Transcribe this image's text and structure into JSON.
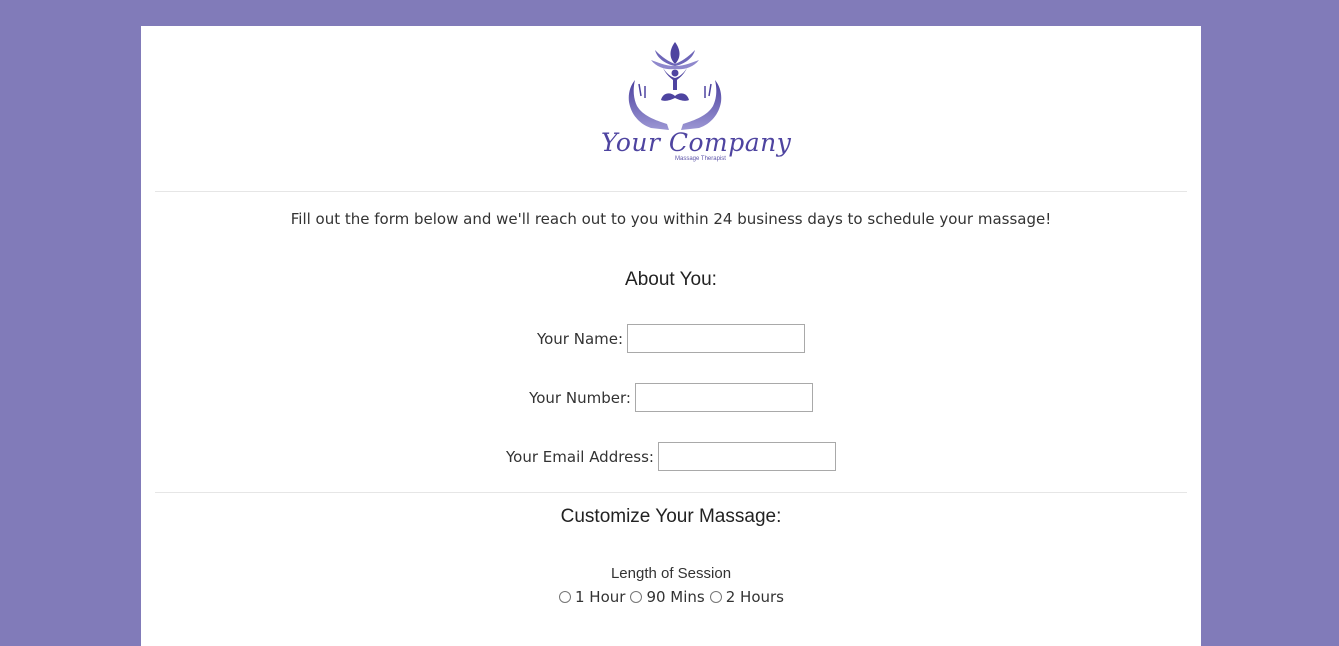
{
  "brand": {
    "name": "Your Company",
    "tagline": "Massage Therapist"
  },
  "intro_text": "Fill out the form below and we'll reach out to you within 24 business days to schedule your massage!",
  "about_section": {
    "heading": "About You:",
    "fields": {
      "name_label": "Your Name:",
      "name_value": "",
      "number_label": "Your Number:",
      "number_value": "",
      "email_label": "Your Email Address:",
      "email_value": ""
    }
  },
  "customize_section": {
    "heading": "Customize Your Massage:",
    "length_label": "Length of Session",
    "options": {
      "one_hour": "1 Hour",
      "ninety_mins": "90 Mins",
      "two_hours": "2 Hours"
    }
  },
  "colors": {
    "background": "#817bb9",
    "card": "#ffffff",
    "logo": "#5d54a8"
  }
}
